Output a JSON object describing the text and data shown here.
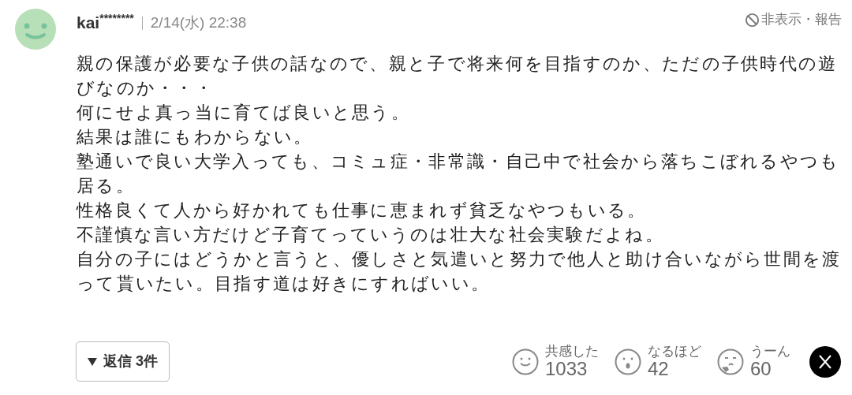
{
  "comment": {
    "user": "kai",
    "user_mask": "********",
    "date": "2/14(水) 22:38",
    "report": "非表示・報告",
    "body": [
      "親の保護が必要な子供の話なので、親と子で将来何を目指すのか、ただの子供時代の遊びなのか・・・",
      "何にせよ真っ当に育てば良いと思う。",
      "結果は誰にもわからない。",
      "塾通いで良い大学入っても、コミュ症・非常識・自己中で社会から落ちこぼれるやつも居る。",
      "性格良くて人から好かれても仕事に恵まれず貧乏なやつもいる。",
      "不謹慎な言い方だけど子育てっていうのは壮大な社会実験だよね。",
      "自分の子にはどうかと言うと、優しさと気遣いと努力で他人と助け合いながら世間を渡って貰いたい。目指す道は好きにすればいい。"
    ],
    "replies": "返信 3件",
    "reactions": [
      {
        "kind": "smile",
        "label": "共感した",
        "count": "1033"
      },
      {
        "kind": "surprised",
        "label": "なるほど",
        "count": "42"
      },
      {
        "kind": "thinking",
        "label": "うーん",
        "count": "60"
      }
    ]
  }
}
